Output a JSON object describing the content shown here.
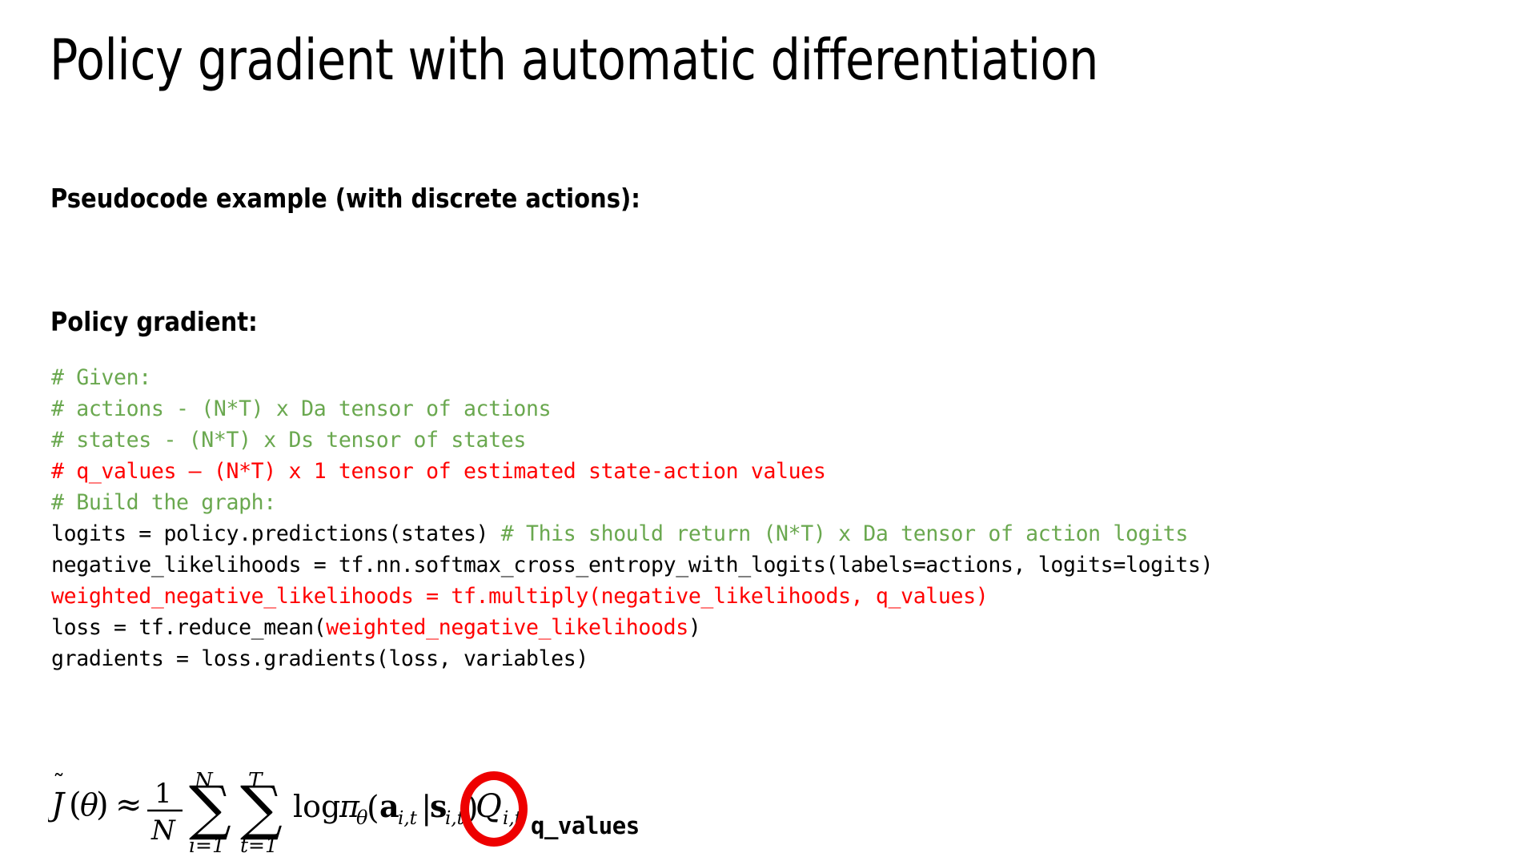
{
  "slide": {
    "title": "Policy gradient with automatic differentiation",
    "lead_line": "Pseudocode example (with discrete actions):",
    "section_heading": "Policy gradient:"
  },
  "colors": {
    "comment_green": "#6aa84f",
    "highlight_red": "#ff0000",
    "ellipse_red": "#ee0000",
    "text_black": "#000000",
    "background": "#ffffff"
  },
  "code": {
    "language": "python",
    "lines": [
      {
        "index": 1,
        "text": "# Given:",
        "spans": [
          {
            "text": "# Given:",
            "color": "comment"
          }
        ]
      },
      {
        "index": 2,
        "text": "# actions - (N*T) x Da tensor of actions",
        "spans": [
          {
            "text": "# actions - (N*T) x Da tensor of actions",
            "color": "comment"
          }
        ]
      },
      {
        "index": 3,
        "text": "# states - (N*T) x Ds tensor of states",
        "spans": [
          {
            "text": "# states - (N*T) x Ds tensor of states",
            "color": "comment"
          }
        ]
      },
      {
        "index": 4,
        "text": "# q_values – (N*T) x 1 tensor of estimated state-action values",
        "spans": [
          {
            "text": "# q_values – (N*T) x 1 tensor of estimated state-action values",
            "color": "red"
          }
        ]
      },
      {
        "index": 5,
        "text": "# Build the graph:",
        "spans": [
          {
            "text": "# Build the graph:",
            "color": "comment"
          }
        ]
      },
      {
        "index": 6,
        "text": "logits = policy.predictions(states) # This should return (N*T) x Da tensor of action logits",
        "spans": [
          {
            "text": "logits = policy.predictions(states) ",
            "color": "plain"
          },
          {
            "text": "# This should return (N*T) x Da tensor of action logits",
            "color": "comment"
          }
        ]
      },
      {
        "index": 7,
        "text": "negative_likelihoods = tf.nn.softmax_cross_entropy_with_logits(labels=actions, logits=logits)",
        "spans": [
          {
            "text": "negative_likelihoods = tf.nn.softmax_cross_entropy_with_logits(labels=actions, logits=logits)",
            "color": "plain"
          }
        ]
      },
      {
        "index": 8,
        "text": "weighted_negative_likelihoods = tf.multiply(negative_likelihoods, q_values)",
        "spans": [
          {
            "text": "weighted_negative_likelihoods = tf.multiply(negative_likelihoods, q_values)",
            "color": "red"
          }
        ]
      },
      {
        "index": 9,
        "text": "loss = tf.reduce_mean(weighted_negative_likelihoods)",
        "spans": [
          {
            "text": "loss = tf.reduce_mean(",
            "color": "plain"
          },
          {
            "text": "weighted_negative_likelihoods",
            "color": "red"
          },
          {
            "text": ")",
            "color": "plain"
          }
        ]
      },
      {
        "index": 10,
        "text": "gradients = loss.gradients(loss, variables)",
        "spans": [
          {
            "text": "gradients = loss.gradients(loss, variables)",
            "color": "plain"
          }
        ]
      }
    ]
  },
  "formula": {
    "latex": "\\tilde{J}(\\theta) \\approx \\frac{1}{N} \\sum_{i=1}^{N} \\sum_{t=1}^{T} \\log \\pi_{\\theta}(\\mathbf{a}_{i,t}|\\mathbf{s}_{i,t}) \\hat{Q}_{i,t}",
    "parts": {
      "lhs": "J̃(θ)",
      "approx": "≈",
      "fraction_numerator": "1",
      "fraction_denominator": "N",
      "sum1_upper": "N",
      "sum1_lower": "i=1",
      "sum2_upper": "T",
      "sum2_lower": "t=1",
      "log": "log",
      "policy": "π",
      "policy_subscript": "θ",
      "action": "a",
      "action_subscript": "i,t",
      "state": "s",
      "state_subscript": "i,t",
      "qhat": "Q̂",
      "qhat_subscript": "i,t"
    },
    "highlight": {
      "target": "Q̂_{i,t}",
      "shape": "ellipse",
      "color": "#ee0000"
    },
    "callout_label": "q_values"
  }
}
